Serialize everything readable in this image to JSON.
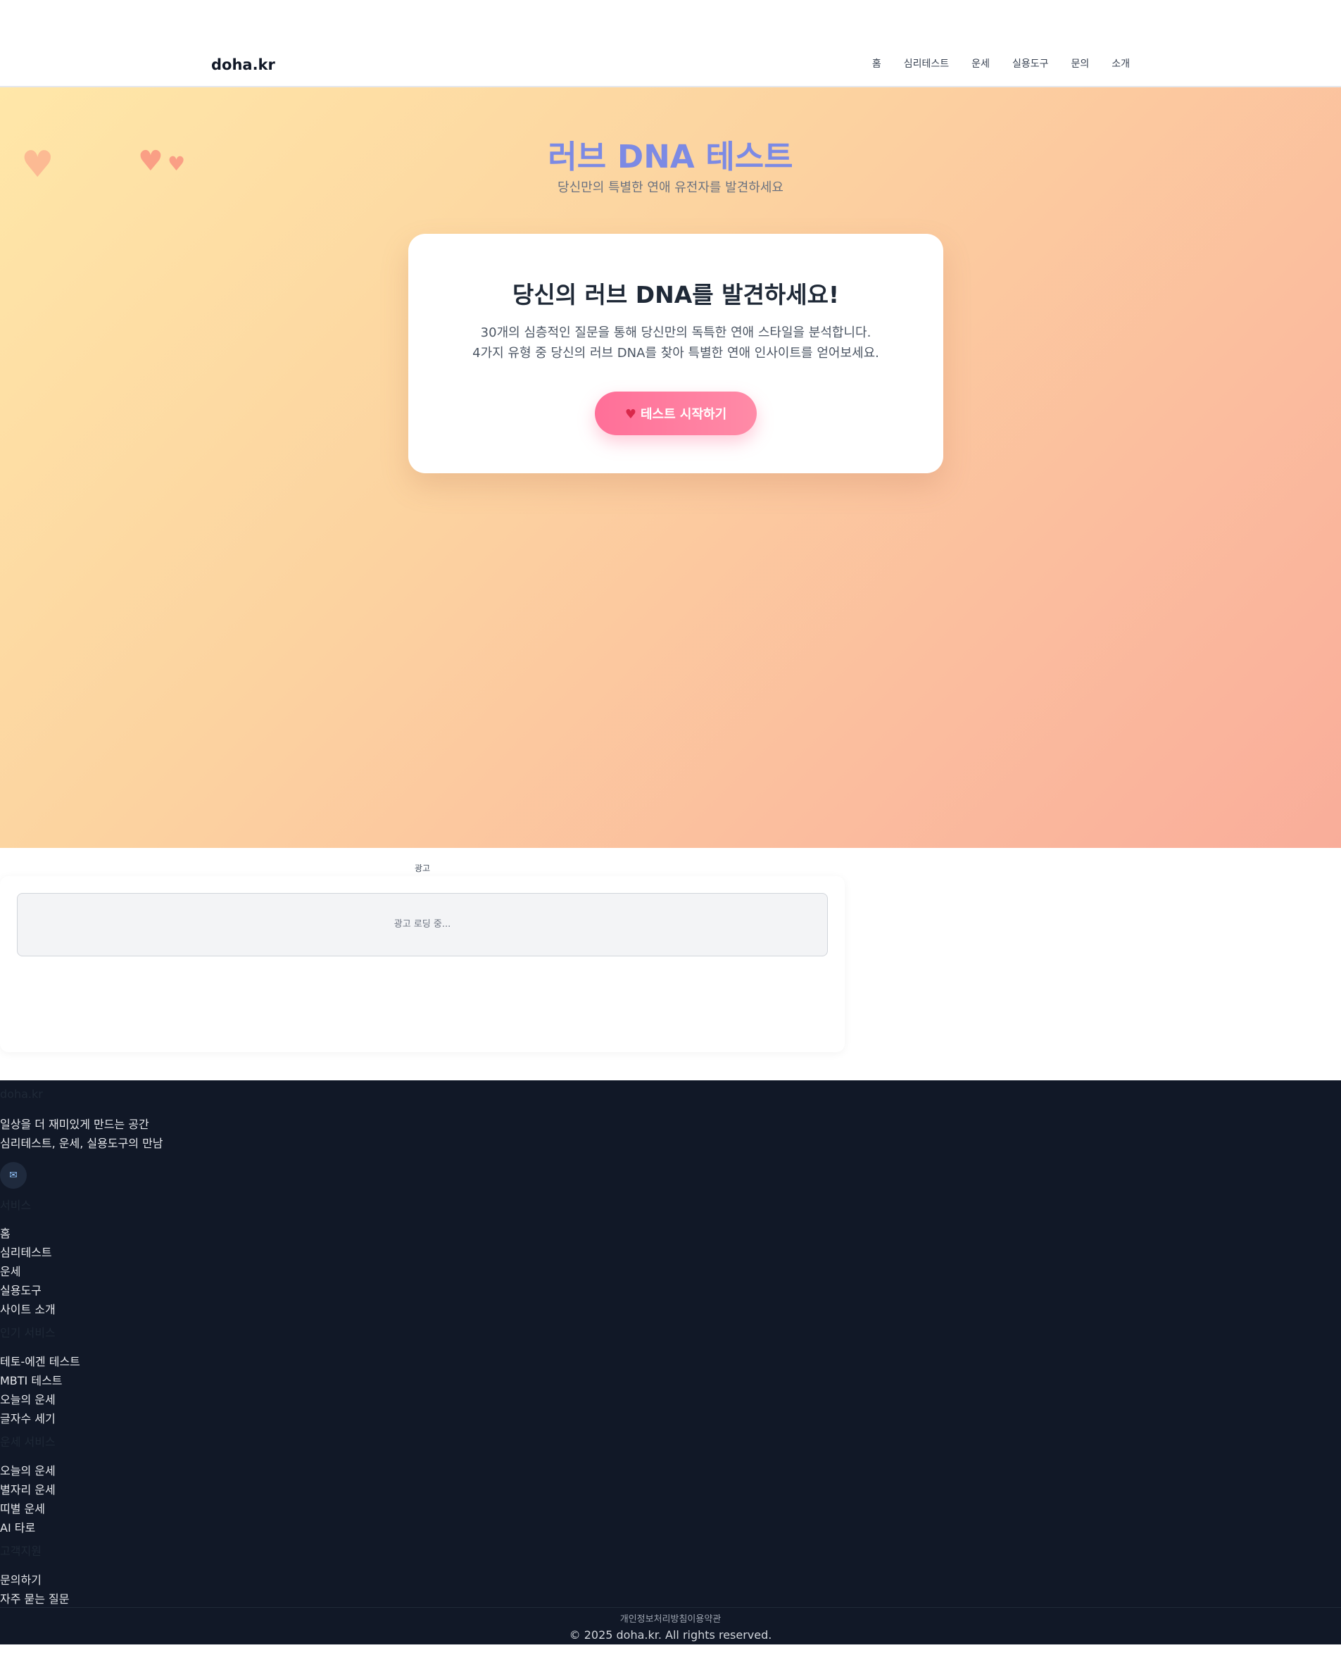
{
  "brand": "doha.kr",
  "nav": [
    "홈",
    "심리테스트",
    "운세",
    "실용도구",
    "문의",
    "소개"
  ],
  "hero": {
    "title": "러브 DNA 테스트",
    "subtitle": "당신만의 특별한 연애 유전자를 발견하세요",
    "heart_icon": "heart-icon",
    "accent_color": "#7c8ae4"
  },
  "intro": {
    "heading": "당신의 러브 DNA를 발견하세요!",
    "line1": "30개의 심층적인 질문을 통해 당신만의 독특한 연애 스타일을 분석합니다.",
    "line2": "4가지 유형 중 당신의 러브 DNA를 찾아 특별한 연애 인사이트를 얻어보세요.",
    "button_label": "테스트 시작하기",
    "button_color": "#ff6f98"
  },
  "ad": {
    "label": "광고",
    "loading": "광고 로딩 중..."
  },
  "footer": {
    "brand_heading": "doha.kr",
    "tagline1": "일상을 더 재미있게 만드는 공간",
    "tagline2": "심리테스트, 운세, 실용도구의 만남",
    "email_icon": "mail-icon",
    "sections": [
      {
        "heading": "서비스",
        "links": [
          "홈",
          "심리테스트",
          "운세",
          "실용도구",
          "사이트 소개"
        ]
      },
      {
        "heading": "인기 서비스",
        "links": [
          "테토-에겐 테스트",
          "MBTI 테스트",
          "오늘의 운세",
          "글자수 세기"
        ]
      },
      {
        "heading": "운세 서비스",
        "links": [
          "오늘의 운세",
          "별자리 운세",
          "띠별 운세",
          "AI 타로"
        ]
      },
      {
        "heading": "고객지원",
        "links": [
          "문의하기",
          "자주 묻는 질문"
        ]
      }
    ],
    "legal": "개인정보처리방침이용약관",
    "copyright": "© 2025 doha.kr. All rights reserved.",
    "background": "#111827"
  }
}
